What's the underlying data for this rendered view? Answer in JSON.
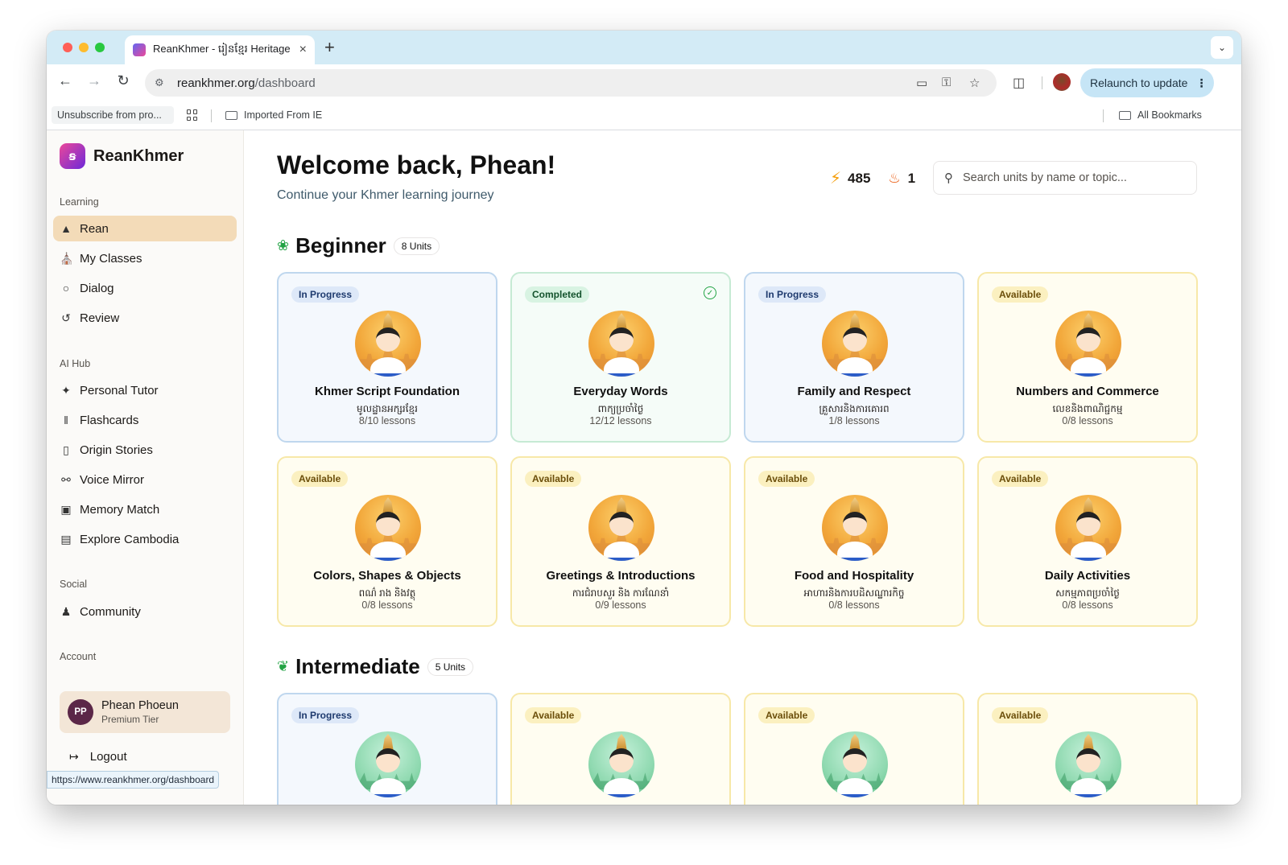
{
  "browser": {
    "tab_title": "ReanKhmer - រៀនខ្មែរ Heritage",
    "tab_close": "×",
    "new_tab": "+",
    "url_domain": "reankhmer.org",
    "url_path": "/dashboard",
    "relaunch": "Relaunch to update",
    "bookmarks": [
      "Unsubscribe from pro...",
      "Imported From IE"
    ],
    "all_bookmarks": "All Bookmarks",
    "status_url": "https://www.reankhmer.org/dashboard"
  },
  "app": {
    "brand": "ReanKhmer",
    "logo_glyph": "ꞩ"
  },
  "sidebar": {
    "sections": [
      {
        "label": "Learning",
        "items": [
          {
            "label": "Rean",
            "icon": "graduation-cap-icon",
            "active": true
          },
          {
            "label": "My Classes",
            "icon": "school-icon"
          },
          {
            "label": "Dialog",
            "icon": "chat-bubble-icon"
          },
          {
            "label": "Review",
            "icon": "rotate-icon"
          }
        ]
      },
      {
        "label": "AI Hub",
        "items": [
          {
            "label": "Personal Tutor",
            "icon": "sparkles-icon"
          },
          {
            "label": "Flashcards",
            "icon": "library-icon"
          },
          {
            "label": "Origin Stories",
            "icon": "book-icon"
          },
          {
            "label": "Voice Mirror",
            "icon": "microphone-icon"
          },
          {
            "label": "Memory Match",
            "icon": "gamepad-icon"
          },
          {
            "label": "Explore Cambodia",
            "icon": "map-icon"
          }
        ]
      },
      {
        "label": "Social",
        "items": [
          {
            "label": "Community",
            "icon": "users-icon"
          }
        ]
      },
      {
        "label": "Account",
        "items": []
      }
    ],
    "user": {
      "initials": "PP",
      "name": "Phean Phoeun",
      "tier": "Premium Tier"
    },
    "logout": "Logout"
  },
  "header": {
    "welcome": "Welcome back, Phean!",
    "subtitle": "Continue your Khmer learning journey",
    "xp": "485",
    "streak": "1",
    "search_placeholder": "Search units by name or topic..."
  },
  "levels": [
    {
      "title": "Beginner",
      "count": "8 Units",
      "units": [
        {
          "status": "In Progress",
          "title": "Khmer Script Foundation",
          "khmer": "មូលដ្ឋានអក្សរខ្មែរ",
          "lessons": "8/10 lessons",
          "kind": "prog"
        },
        {
          "status": "Completed",
          "title": "Everyday Words",
          "khmer": "ពាក្យប្រចាំថ្ងៃ",
          "lessons": "12/12 lessons",
          "kind": "done"
        },
        {
          "status": "In Progress",
          "title": "Family and Respect",
          "khmer": "គ្រួសារនិងការគោរព",
          "lessons": "1/8 lessons",
          "kind": "prog"
        },
        {
          "status": "Available",
          "title": "Numbers and Commerce",
          "khmer": "លេខនិងពាណិជ្ជកម្ម",
          "lessons": "0/8 lessons",
          "kind": "avail"
        },
        {
          "status": "Available",
          "title": "Colors, Shapes & Objects",
          "khmer": "ពណ៌ រាង និងវត្ថុ",
          "lessons": "0/8 lessons",
          "kind": "avail"
        },
        {
          "status": "Available",
          "title": "Greetings & Introductions",
          "khmer": "ការជំរាបសួរ និង ការណែនាំ",
          "lessons": "0/9 lessons",
          "kind": "avail"
        },
        {
          "status": "Available",
          "title": "Food and Hospitality",
          "khmer": "អាហារនិងការបដិសណ្ឋារកិច្ច",
          "lessons": "0/8 lessons",
          "kind": "avail"
        },
        {
          "status": "Available",
          "title": "Daily Activities",
          "khmer": "សកម្មភាពប្រចាំថ្ងៃ",
          "lessons": "0/8 lessons",
          "kind": "avail"
        }
      ]
    },
    {
      "title": "Intermediate",
      "count": "5 Units",
      "units": [
        {
          "status": "In Progress",
          "kind": "prog"
        },
        {
          "status": "Available",
          "kind": "avail"
        },
        {
          "status": "Available",
          "kind": "avail"
        },
        {
          "status": "Available",
          "kind": "avail"
        }
      ]
    }
  ]
}
